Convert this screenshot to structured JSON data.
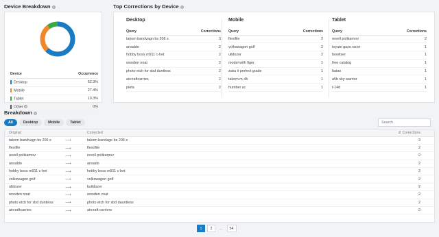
{
  "device_breakdown": {
    "title": "Device Breakdown",
    "header_device": "Device",
    "header_occurrence": "Occurrence",
    "rows": [
      {
        "label": "Desktop",
        "value": "62.3%",
        "color": "#1a7bc2",
        "pct": 62.3
      },
      {
        "label": "Mobile",
        "value": "27.4%",
        "color": "#f0872a",
        "pct": 27.4
      },
      {
        "label": "Tablet",
        "value": "10.3%",
        "color": "#3aa845",
        "pct": 10.3
      },
      {
        "label": "Other",
        "value": "0%",
        "color": "#555555",
        "pct": 0
      }
    ]
  },
  "top_corrections": {
    "title": "Top Corrections by Device",
    "query_header": "Query",
    "corrections_header": "Corrections",
    "columns": [
      {
        "device": "Desktop",
        "rows": [
          {
            "q": "takom bandvagn bs 206 s",
            "c": "3"
          },
          {
            "q": "ansaldo",
            "c": "2"
          },
          {
            "q": "hobby boss m911 c-het",
            "c": "2"
          },
          {
            "q": "wooden noat",
            "c": "2"
          },
          {
            "q": "photo etch for sbd duntless",
            "c": "2"
          },
          {
            "q": "aircraftcarries",
            "c": "2"
          },
          {
            "q": "pieta",
            "c": "2"
          }
        ]
      },
      {
        "device": "Mobile",
        "rows": [
          {
            "q": "flexifile",
            "c": "2"
          },
          {
            "q": "volkswagon golf",
            "c": "2"
          },
          {
            "q": "ulldozer",
            "c": "2"
          },
          {
            "q": "model with figer",
            "c": "1"
          },
          {
            "q": "zaku ii perfect grade",
            "c": "1"
          },
          {
            "q": "takom m-4h",
            "c": "1"
          },
          {
            "q": "humber sc",
            "c": "1"
          }
        ]
      },
      {
        "device": "Tablet",
        "rows": [
          {
            "q": "revell polikarnov",
            "c": "2"
          },
          {
            "q": "toyato gazo racer",
            "c": "1"
          },
          {
            "q": "howitser",
            "c": "1"
          },
          {
            "q": "free catalog",
            "c": "1"
          },
          {
            "q": "balao",
            "c": "1"
          },
          {
            "q": "a5b sky warrior",
            "c": "1"
          },
          {
            "q": "t-14d",
            "c": "1"
          }
        ]
      }
    ]
  },
  "breakdown": {
    "title": "Breakdown",
    "tabs": [
      "All",
      "Desktop",
      "Mobile",
      "Tablet"
    ],
    "active_tab": "All",
    "search_placeholder": "Search",
    "headers": {
      "original": "Original",
      "corrected": "Corrected",
      "corrections": "Corrections"
    },
    "arrow": "⟶",
    "rows": [
      {
        "o": "takom bandvagn bs 206 s",
        "c": "takom bandage bs 206 s",
        "n": "3"
      },
      {
        "o": "flexifile",
        "c": "flexofile",
        "n": "2"
      },
      {
        "o": "revell polikarnov",
        "c": "revell polikarpov",
        "n": "2"
      },
      {
        "o": "ansaldo",
        "c": "ansado",
        "n": "2"
      },
      {
        "o": "hobby boss m911 c-het",
        "c": "hobby boss m911 c-het",
        "n": "2"
      },
      {
        "o": "volkswagon golf",
        "c": "volkswagen golf",
        "n": "2"
      },
      {
        "o": "ulldozer",
        "c": "bulldozer",
        "n": "2"
      },
      {
        "o": "wooden noat",
        "c": "wooden coat",
        "n": "2"
      },
      {
        "o": "photo etch for sbd duntless",
        "c": "photo etch for sbd dauntless",
        "n": "2"
      },
      {
        "o": "aircraftcarries",
        "c": "aircraft carriers",
        "n": "2"
      }
    ]
  },
  "pagination": {
    "pages": [
      "1",
      "2",
      "54"
    ],
    "ellipsis": "...",
    "current": "1"
  },
  "info_glyph": "i"
}
